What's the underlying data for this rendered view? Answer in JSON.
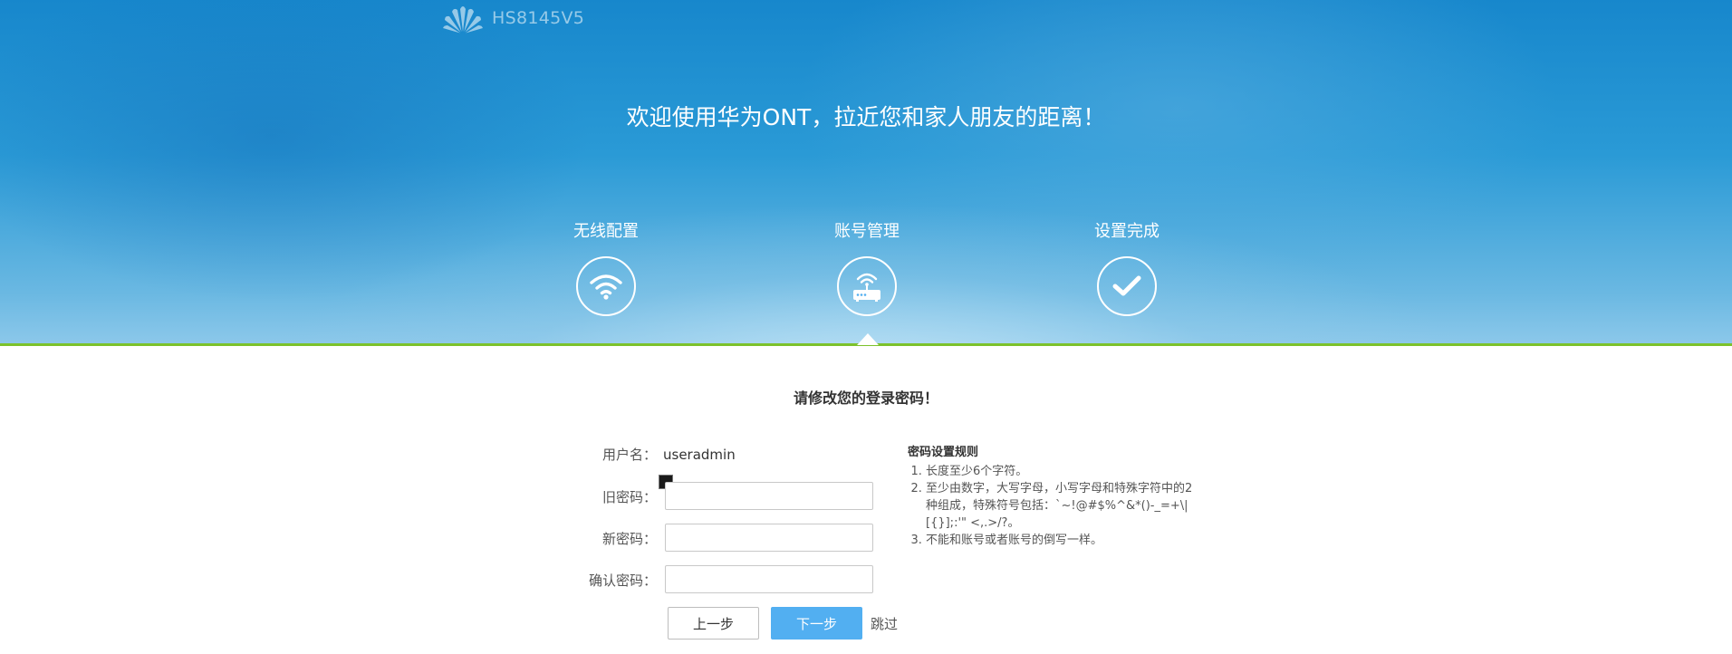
{
  "header": {
    "brand_logo": "huawei-logo",
    "model": "HS8145V5",
    "welcome": "欢迎使用华为ONT，拉近您和家人朋友的距离！"
  },
  "steps": [
    {
      "label": "无线配置",
      "icon": "wifi-icon"
    },
    {
      "label": "账号管理",
      "icon": "router-icon"
    },
    {
      "label": "设置完成",
      "icon": "checkmark-icon"
    }
  ],
  "active_step": 1,
  "form": {
    "title": "请修改您的登录密码！",
    "username_label": "用户名：",
    "username_value": "useradmin",
    "old_password_label": "旧密码：",
    "old_password_value": "",
    "new_password_label": "新密码：",
    "new_password_value": "",
    "confirm_password_label": "确认密码：",
    "confirm_password_value": ""
  },
  "rules": {
    "title": "密码设置规则",
    "items": [
      "长度至少6个字符。",
      "至少由数字，大写字母，小写字母和特殊字符中的2种组成，特殊符号包括：`~!@#$%^&*()-_=+\\|[{}];:'\" <,.>/?。",
      "不能和账号或者账号的倒写一样。"
    ]
  },
  "buttons": {
    "prev": "上一步",
    "next": "下一步",
    "skip": "跳过"
  },
  "colors": {
    "accent_green": "#7cc22c",
    "primary_button": "#52aff1",
    "hero_blue": "#1787cc"
  }
}
